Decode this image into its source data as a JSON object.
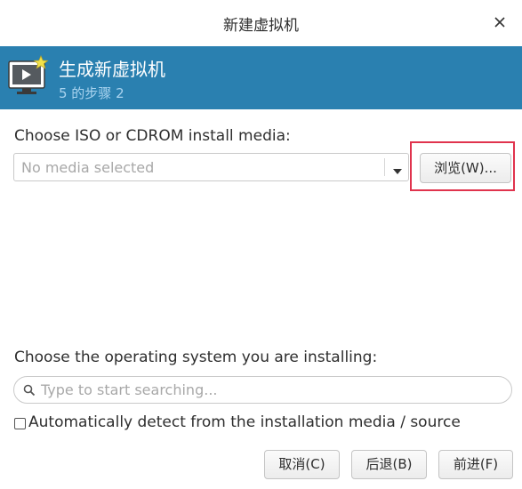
{
  "window": {
    "title": "新建虚拟机",
    "close_icon": "close-icon"
  },
  "banner": {
    "heading": "生成新虚拟机",
    "step": "5 的步骤 2",
    "icon": "vm-monitor-icon",
    "background": "#2a80b0"
  },
  "media": {
    "label": "Choose ISO or CDROM install media:",
    "combo_placeholder": "No media selected",
    "browse_button": "浏览(W)...",
    "highlight_color": "#e0334d"
  },
  "os": {
    "label": "Choose the operating system you are installing:",
    "search_placeholder": "Type to start searching...",
    "search_icon": "search-icon",
    "autodetect_label": "Automatically detect from the installation media / source",
    "autodetect_checked": false
  },
  "footer": {
    "cancel_label": "取消(C)",
    "back_label": "后退(B)",
    "next_label": "前进(F)"
  }
}
